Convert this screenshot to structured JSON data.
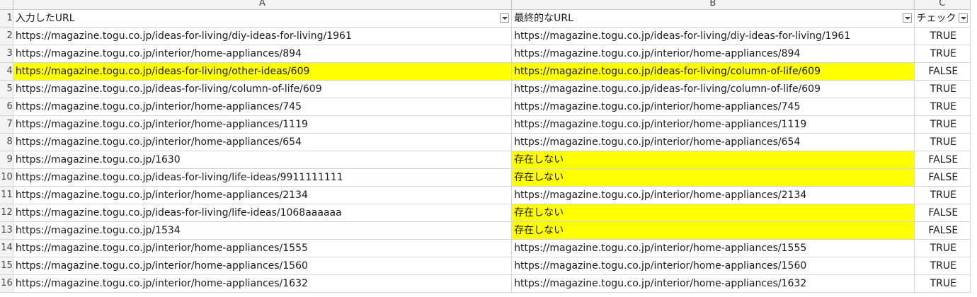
{
  "columns": [
    "A",
    "B",
    "C"
  ],
  "headers": {
    "a": "入力したURL",
    "b": "最終的なURL",
    "c": "チェック"
  },
  "highlight_color": "#ffff00",
  "rows": [
    {
      "num": "2",
      "input": "https://magazine.togu.co.jp/ideas-for-living/diy-ideas-for-living/1961",
      "final": "https://magazine.togu.co.jp/ideas-for-living/diy-ideas-for-living/1961",
      "check": "TRUE"
    },
    {
      "num": "3",
      "input": "https://magazine.togu.co.jp/interior/home-appliances/894",
      "final": "https://magazine.togu.co.jp/interior/home-appliances/894",
      "check": "TRUE"
    },
    {
      "num": "4",
      "input": "https://magazine.togu.co.jp/ideas-for-living/other-ideas/609",
      "final": "https://magazine.togu.co.jp/ideas-for-living/column-of-life/609",
      "check": "FALSE"
    },
    {
      "num": "5",
      "input": "https://magazine.togu.co.jp/ideas-for-living/column-of-life/609",
      "final": "https://magazine.togu.co.jp/ideas-for-living/column-of-life/609",
      "check": "TRUE"
    },
    {
      "num": "6",
      "input": "https://magazine.togu.co.jp/interior/home-appliances/745",
      "final": "https://magazine.togu.co.jp/interior/home-appliances/745",
      "check": "TRUE"
    },
    {
      "num": "7",
      "input": "https://magazine.togu.co.jp/interior/home-appliances/1119",
      "final": "https://magazine.togu.co.jp/interior/home-appliances/1119",
      "check": "TRUE"
    },
    {
      "num": "8",
      "input": "https://magazine.togu.co.jp/interior/home-appliances/654",
      "final": "https://magazine.togu.co.jp/interior/home-appliances/654",
      "check": "TRUE"
    },
    {
      "num": "9",
      "input": "https://magazine.togu.co.jp/1630",
      "final": "存在しない",
      "check": "FALSE"
    },
    {
      "num": "10",
      "input": "https://magazine.togu.co.jp/ideas-for-living/life-ideas/9911111111",
      "final": "存在しない",
      "check": "FALSE"
    },
    {
      "num": "11",
      "input": "https://magazine.togu.co.jp/interior/home-appliances/2134",
      "final": "https://magazine.togu.co.jp/interior/home-appliances/2134",
      "check": "TRUE"
    },
    {
      "num": "12",
      "input": "https://magazine.togu.co.jp/ideas-for-living/life-ideas/1068aaaaaa",
      "final": "存在しない",
      "check": "FALSE"
    },
    {
      "num": "13",
      "input": "https://magazine.togu.co.jp/1534",
      "final": "存在しない",
      "check": "FALSE"
    },
    {
      "num": "14",
      "input": "https://magazine.togu.co.jp/interior/home-appliances/1555",
      "final": "https://magazine.togu.co.jp/interior/home-appliances/1555",
      "check": "TRUE"
    },
    {
      "num": "15",
      "input": "https://magazine.togu.co.jp/interior/home-appliances/1560",
      "final": "https://magazine.togu.co.jp/interior/home-appliances/1560",
      "check": "TRUE"
    },
    {
      "num": "16",
      "input": "https://magazine.togu.co.jp/interior/home-appliances/1632",
      "final": "https://magazine.togu.co.jp/interior/home-appliances/1632",
      "check": "TRUE"
    }
  ]
}
